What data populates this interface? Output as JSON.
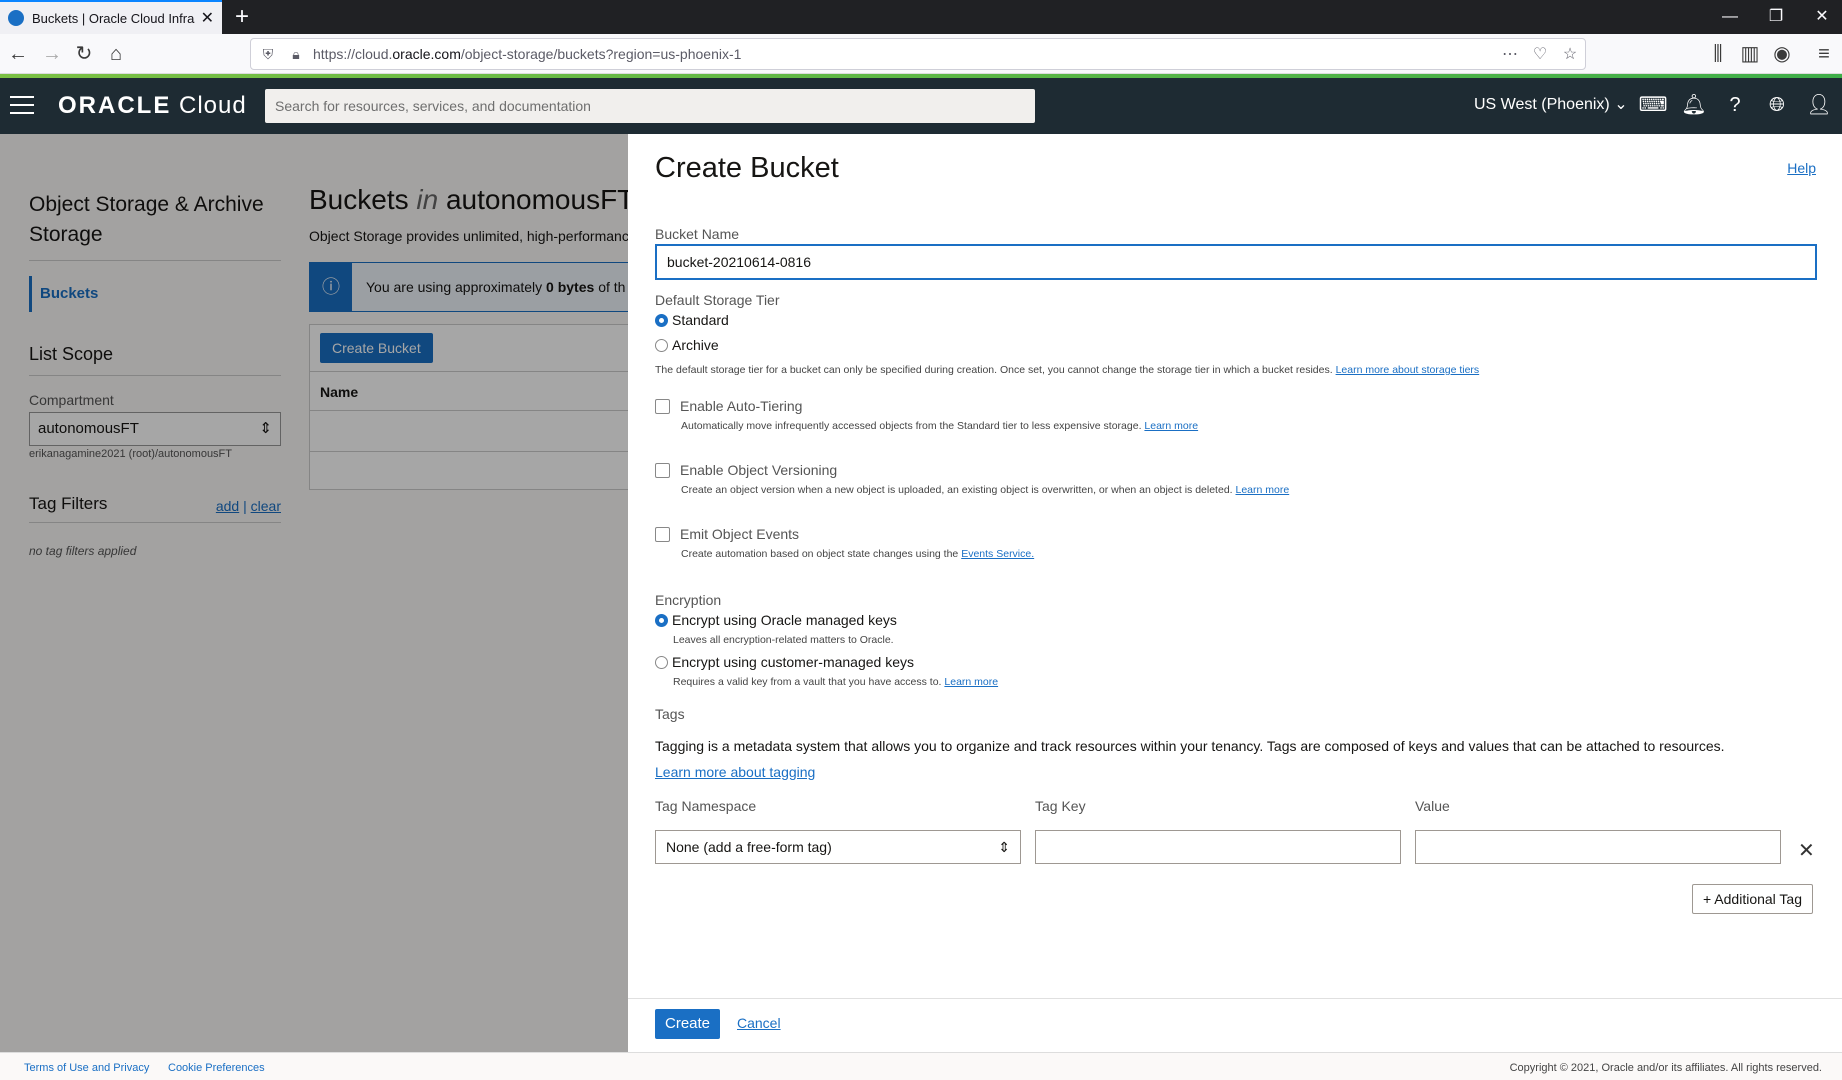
{
  "browser": {
    "tab_title": "Buckets | Oracle Cloud Infrastru",
    "url_host": "https://cloud.",
    "url_domain": "oracle.com",
    "url_path": "/object-storage/buckets?region=us-phoenix-1",
    "back_icon": "back-arrow-icon",
    "forward_icon": "forward-arrow-icon"
  },
  "header": {
    "brand_bold": "ORACLE",
    "brand_light": "Cloud",
    "search_placeholder": "Search for resources, services, and documentation",
    "region": "US West (Phoenix)"
  },
  "sidebar": {
    "title": "Object Storage & Archive Storage",
    "nav_buckets": "Buckets",
    "list_scope": "List Scope",
    "compartment_label": "Compartment",
    "compartment_value": "autonomousFT",
    "compartment_path": "erikanagamine2021 (root)/autonomousFT",
    "tag_filters": "Tag Filters",
    "add": "add",
    "clear": "clear",
    "no_tags": "no tag filters applied"
  },
  "buckets_page": {
    "title_a": "Buckets",
    "title_in": "in",
    "title_b": "autonomousFT",
    "description": "Object Storage provides unlimited, high-performance",
    "info_prefix": "You are using approximately",
    "info_bold": "0 bytes",
    "info_suffix": "of th",
    "create_button": "Create Bucket",
    "column_name": "Name"
  },
  "panel": {
    "title": "Create Bucket",
    "help": "Help",
    "bucket_name_label": "Bucket Name",
    "bucket_name_value": "bucket-20210614-0816",
    "storage_tier_label": "Default Storage Tier",
    "tier_standard": "Standard",
    "tier_archive": "Archive",
    "tier_help": "The default storage tier for a bucket can only be specified during creation. Once set, you cannot change the storage tier in which a bucket resides.",
    "tier_help_link": "Learn more about storage tiers",
    "autotier_label": "Enable Auto-Tiering",
    "autotier_help": "Automatically move infrequently accessed objects from the Standard tier to less expensive storage.",
    "learn_more": "Learn more",
    "versioning_label": "Enable Object Versioning",
    "versioning_help": "Create an object version when a new object is uploaded, an existing object is overwritten, or when an object is deleted.",
    "events_label": "Emit Object Events",
    "events_help": "Create automation based on object state changes using the",
    "events_link": "Events Service.",
    "encryption_label": "Encryption",
    "enc_oracle": "Encrypt using Oracle managed keys",
    "enc_oracle_help": "Leaves all encryption-related matters to Oracle.",
    "enc_customer": "Encrypt using customer-managed keys",
    "enc_customer_help": "Requires a valid key from a vault that you have access to.",
    "tags_label": "Tags",
    "tags_desc": "Tagging is a metadata system that allows you to organize and track resources within your tenancy. Tags are composed of keys and values that can be attached to resources.",
    "tags_link": "Learn more about tagging",
    "tag_namespace_label": "Tag Namespace",
    "tag_key_label": "Tag Key",
    "value_label": "Value",
    "tag_namespace_value": "None (add a free-form tag)",
    "additional_tag": "+ Additional Tag",
    "create": "Create",
    "cancel": "Cancel"
  },
  "footer": {
    "terms": "Terms of Use and Privacy",
    "cookies": "Cookie Preferences",
    "copyright": "Copyright © 2021, Oracle and/or its affiliates. All rights reserved."
  },
  "colors": {
    "accent": "#1a6fc4",
    "header_bg": "#1e2b33"
  }
}
